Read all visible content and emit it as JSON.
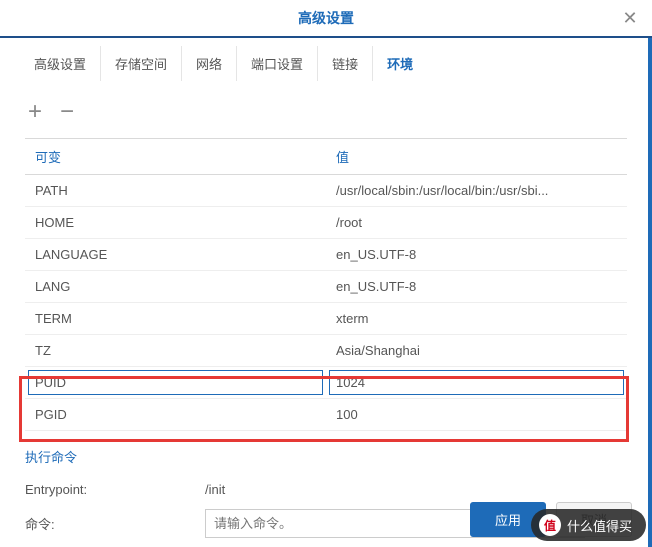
{
  "title": "高级设置",
  "tabs": [
    "高级设置",
    "存储空间",
    "网络",
    "端口设置",
    "链接",
    "环境"
  ],
  "active_tab_index": 5,
  "table": {
    "headers": {
      "var": "可变",
      "val": "值"
    },
    "rows": [
      {
        "var": "PATH",
        "val": "/usr/local/sbin:/usr/local/bin:/usr/sbi..."
      },
      {
        "var": "HOME",
        "val": "/root"
      },
      {
        "var": "LANGUAGE",
        "val": "en_US.UTF-8"
      },
      {
        "var": "LANG",
        "val": "en_US.UTF-8"
      },
      {
        "var": "TERM",
        "val": "xterm"
      },
      {
        "var": "TZ",
        "val": "Asia/Shanghai"
      },
      {
        "var": "PUID",
        "val": "1024",
        "editing": true
      },
      {
        "var": "PGID",
        "val": "100"
      }
    ]
  },
  "exec_section": {
    "title": "执行命令",
    "entrypoint_label": "Entrypoint:",
    "entrypoint_value": "/init",
    "command_label": "命令:",
    "command_placeholder": "请输入命令。"
  },
  "buttons": {
    "apply": "应用",
    "cancel": "取消"
  },
  "watermark": {
    "badge": "值",
    "text": "什么值得买"
  }
}
